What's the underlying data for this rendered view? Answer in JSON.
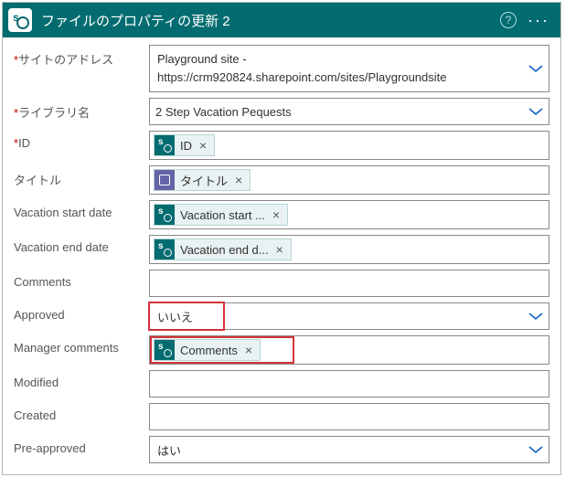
{
  "header": {
    "title": "ファイルのプロパティの更新 2"
  },
  "labels": {
    "site_address": "サイトのアドレス",
    "library_name": "ライブラリ名",
    "id": "ID",
    "title_field": "タイトル",
    "vac_start": "Vacation start date",
    "vac_end": "Vacation end date",
    "comments": "Comments",
    "approved": "Approved",
    "mgr_comments": "Manager comments",
    "modified": "Modified",
    "created": "Created",
    "pre_approved": "Pre-approved"
  },
  "values": {
    "site_line1": "Playground site -",
    "site_line2": "https://crm920824.sharepoint.com/sites/Playgroundsite",
    "library": "2 Step Vacation Pequests",
    "approved": "いいえ",
    "pre_approved": "はい"
  },
  "tokens": {
    "id": "ID",
    "title": "タイトル",
    "vac_start": "Vacation start ...",
    "vac_end": "Vacation end d...",
    "mgr_comments": "Comments",
    "remove": "×"
  }
}
